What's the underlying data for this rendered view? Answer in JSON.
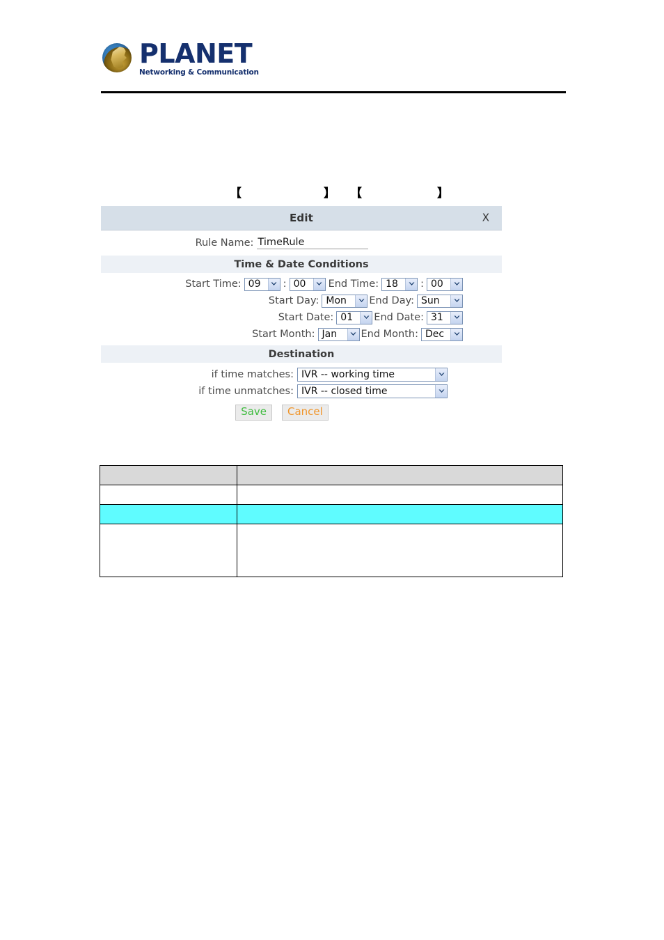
{
  "header": {
    "logo_word": "PLANET",
    "logo_tagline": "Networking & Communication",
    "logo_icon": "planet-globe-logo"
  },
  "captions": [
    {
      "open": "【",
      "text": "",
      "close": "】"
    },
    {
      "open": "【",
      "text": "",
      "close": "】"
    }
  ],
  "dialog": {
    "title": "Edit",
    "close_label": "X",
    "rule_name": {
      "label": "Rule Name:",
      "value": "TimeRule",
      "placeholder": ""
    },
    "sections": {
      "time_date": "Time & Date Conditions",
      "destination": "Destination"
    },
    "time_row": {
      "start_label": "Start Time:",
      "start_hour": "09",
      "separator": ":",
      "start_minute": "00",
      "end_label": "End Time:",
      "end_hour": "18",
      "end_minute": "00"
    },
    "day_row": {
      "start_label": "Start Day:",
      "start_value": "Mon",
      "end_label": "End Day:",
      "end_value": "Sun"
    },
    "date_row": {
      "start_label": "Start Date:",
      "start_value": "01",
      "end_label": "End Date:",
      "end_value": "31"
    },
    "month_row": {
      "start_label": "Start Month:",
      "start_value": "Jan",
      "end_label": "End Month:",
      "end_value": "Dec"
    },
    "destination": {
      "match_label": "if time matches:",
      "match_value": "IVR -- working time",
      "unmatch_label": "if time unmatches:",
      "unmatch_value": "IVR -- closed time"
    },
    "buttons": {
      "save": "Save",
      "cancel": "Cancel"
    }
  },
  "table": {
    "rows": [
      {
        "style": "header",
        "cells": [
          "",
          ""
        ]
      },
      {
        "style": "plain",
        "cells": [
          "",
          ""
        ]
      },
      {
        "style": "highlight",
        "cells": [
          "",
          ""
        ]
      },
      {
        "style": "tall",
        "cells": [
          "",
          ""
        ]
      }
    ]
  },
  "colors": {
    "dialog_titlebar": "#D6DFE8",
    "section_bar": "#EDF1F6",
    "table_header": "#D9D9D9",
    "table_highlight": "#5FFCFF",
    "save_text": "#3DBB3D",
    "cancel_text": "#F0952A",
    "logo_blue": "#15306E"
  }
}
